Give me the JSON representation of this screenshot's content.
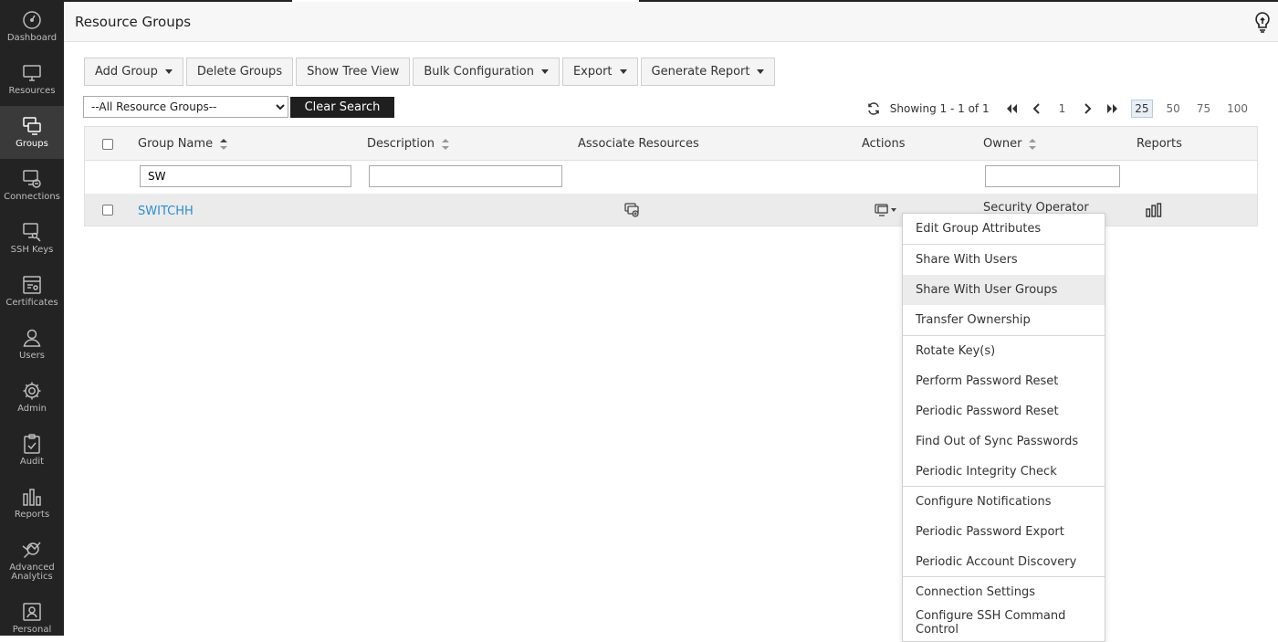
{
  "sidebar": {
    "items": [
      {
        "label": "Dashboard",
        "icon": "dashboard-icon"
      },
      {
        "label": "Resources",
        "icon": "monitor-icon"
      },
      {
        "label": "Groups",
        "icon": "groups-icon",
        "active": true
      },
      {
        "label": "Connections",
        "icon": "connections-icon"
      },
      {
        "label": "SSH Keys",
        "icon": "ssh-key-icon"
      },
      {
        "label": "Certificates",
        "icon": "certificate-icon"
      },
      {
        "label": "Users",
        "icon": "user-icon"
      },
      {
        "label": "Admin",
        "icon": "gear-icon"
      },
      {
        "label": "Audit",
        "icon": "clipboard-check-icon"
      },
      {
        "label": "Reports",
        "icon": "bar-chart-icon"
      },
      {
        "label": "Advanced",
        "label2": "Analytics",
        "icon": "analytics-icon"
      },
      {
        "label": "Personal",
        "icon": "personal-icon"
      }
    ]
  },
  "header": {
    "title": "Resource Groups",
    "help_icon": "lightbulb-icon"
  },
  "toolbar": {
    "add_group": "Add Group",
    "delete_groups": "Delete Groups",
    "show_tree_view": "Show Tree View",
    "bulk_configuration": "Bulk Configuration",
    "export": "Export",
    "generate_report": "Generate Report"
  },
  "filter": {
    "group_select_value": "--All Resource Groups--",
    "clear_search": "Clear Search"
  },
  "pager": {
    "showing": "Showing 1 - 1 of 1",
    "current_page": "1",
    "page_sizes": [
      "25",
      "50",
      "75",
      "100"
    ],
    "active_size": "25"
  },
  "table": {
    "columns": {
      "group_name": "Group Name",
      "description": "Description",
      "associate_resources": "Associate Resources",
      "actions": "Actions",
      "owner": "Owner",
      "reports": "Reports"
    },
    "filters": {
      "group_name": "SW",
      "description": "",
      "owner": ""
    },
    "rows": [
      {
        "group_name": "SWITCHH",
        "owner": "Security Operator"
      }
    ]
  },
  "actions_menu": {
    "sections": [
      [
        "Edit Group Attributes"
      ],
      [
        "Share With Users",
        "Share With User Groups",
        "Transfer Ownership"
      ],
      [
        "Rotate Key(s)",
        "Perform Password Reset",
        "Periodic Password Reset",
        "Find Out of Sync Passwords",
        "Periodic Integrity Check"
      ],
      [
        "Configure Notifications",
        "Periodic Password Export",
        "Periodic Account Discovery"
      ],
      [
        "Connection Settings",
        "Configure SSH Command Control"
      ]
    ],
    "hovered": "Share With User Groups"
  },
  "colors": {
    "sidebar_bg": "#232323",
    "sidebar_active": "#3a3a3a",
    "link": "#2a8ed0",
    "clear_button": "#1f1f1f"
  }
}
